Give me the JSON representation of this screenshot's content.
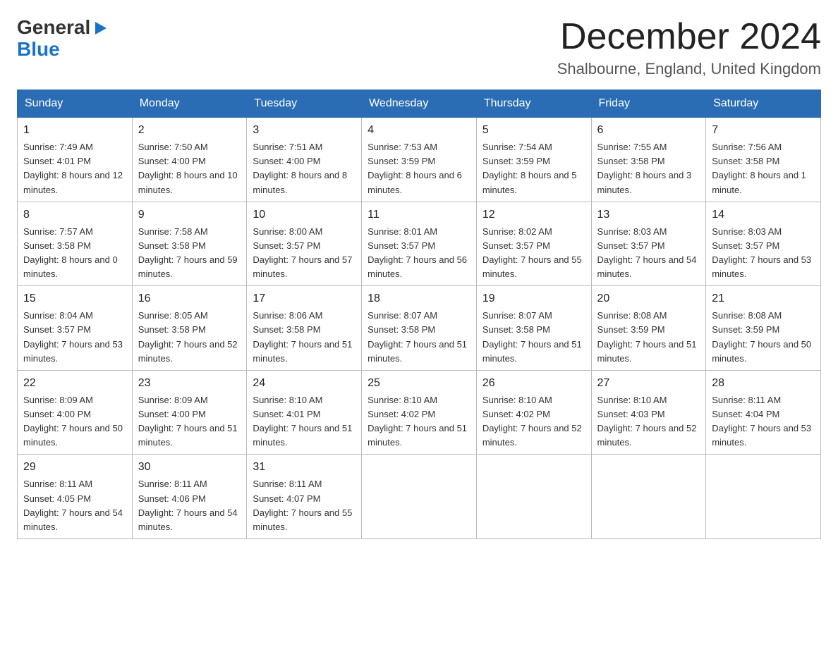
{
  "logo": {
    "general": "General",
    "blue": "Blue",
    "arrow": "▶"
  },
  "title": {
    "month": "December 2024",
    "location": "Shalbourne, England, United Kingdom"
  },
  "weekdays": [
    "Sunday",
    "Monday",
    "Tuesday",
    "Wednesday",
    "Thursday",
    "Friday",
    "Saturday"
  ],
  "weeks": [
    [
      {
        "day": "1",
        "sunrise": "7:49 AM",
        "sunset": "4:01 PM",
        "daylight": "8 hours and 12 minutes."
      },
      {
        "day": "2",
        "sunrise": "7:50 AM",
        "sunset": "4:00 PM",
        "daylight": "8 hours and 10 minutes."
      },
      {
        "day": "3",
        "sunrise": "7:51 AM",
        "sunset": "4:00 PM",
        "daylight": "8 hours and 8 minutes."
      },
      {
        "day": "4",
        "sunrise": "7:53 AM",
        "sunset": "3:59 PM",
        "daylight": "8 hours and 6 minutes."
      },
      {
        "day": "5",
        "sunrise": "7:54 AM",
        "sunset": "3:59 PM",
        "daylight": "8 hours and 5 minutes."
      },
      {
        "day": "6",
        "sunrise": "7:55 AM",
        "sunset": "3:58 PM",
        "daylight": "8 hours and 3 minutes."
      },
      {
        "day": "7",
        "sunrise": "7:56 AM",
        "sunset": "3:58 PM",
        "daylight": "8 hours and 1 minute."
      }
    ],
    [
      {
        "day": "8",
        "sunrise": "7:57 AM",
        "sunset": "3:58 PM",
        "daylight": "8 hours and 0 minutes."
      },
      {
        "day": "9",
        "sunrise": "7:58 AM",
        "sunset": "3:58 PM",
        "daylight": "7 hours and 59 minutes."
      },
      {
        "day": "10",
        "sunrise": "8:00 AM",
        "sunset": "3:57 PM",
        "daylight": "7 hours and 57 minutes."
      },
      {
        "day": "11",
        "sunrise": "8:01 AM",
        "sunset": "3:57 PM",
        "daylight": "7 hours and 56 minutes."
      },
      {
        "day": "12",
        "sunrise": "8:02 AM",
        "sunset": "3:57 PM",
        "daylight": "7 hours and 55 minutes."
      },
      {
        "day": "13",
        "sunrise": "8:03 AM",
        "sunset": "3:57 PM",
        "daylight": "7 hours and 54 minutes."
      },
      {
        "day": "14",
        "sunrise": "8:03 AM",
        "sunset": "3:57 PM",
        "daylight": "7 hours and 53 minutes."
      }
    ],
    [
      {
        "day": "15",
        "sunrise": "8:04 AM",
        "sunset": "3:57 PM",
        "daylight": "7 hours and 53 minutes."
      },
      {
        "day": "16",
        "sunrise": "8:05 AM",
        "sunset": "3:58 PM",
        "daylight": "7 hours and 52 minutes."
      },
      {
        "day": "17",
        "sunrise": "8:06 AM",
        "sunset": "3:58 PM",
        "daylight": "7 hours and 51 minutes."
      },
      {
        "day": "18",
        "sunrise": "8:07 AM",
        "sunset": "3:58 PM",
        "daylight": "7 hours and 51 minutes."
      },
      {
        "day": "19",
        "sunrise": "8:07 AM",
        "sunset": "3:58 PM",
        "daylight": "7 hours and 51 minutes."
      },
      {
        "day": "20",
        "sunrise": "8:08 AM",
        "sunset": "3:59 PM",
        "daylight": "7 hours and 51 minutes."
      },
      {
        "day": "21",
        "sunrise": "8:08 AM",
        "sunset": "3:59 PM",
        "daylight": "7 hours and 50 minutes."
      }
    ],
    [
      {
        "day": "22",
        "sunrise": "8:09 AM",
        "sunset": "4:00 PM",
        "daylight": "7 hours and 50 minutes."
      },
      {
        "day": "23",
        "sunrise": "8:09 AM",
        "sunset": "4:00 PM",
        "daylight": "7 hours and 51 minutes."
      },
      {
        "day": "24",
        "sunrise": "8:10 AM",
        "sunset": "4:01 PM",
        "daylight": "7 hours and 51 minutes."
      },
      {
        "day": "25",
        "sunrise": "8:10 AM",
        "sunset": "4:02 PM",
        "daylight": "7 hours and 51 minutes."
      },
      {
        "day": "26",
        "sunrise": "8:10 AM",
        "sunset": "4:02 PM",
        "daylight": "7 hours and 52 minutes."
      },
      {
        "day": "27",
        "sunrise": "8:10 AM",
        "sunset": "4:03 PM",
        "daylight": "7 hours and 52 minutes."
      },
      {
        "day": "28",
        "sunrise": "8:11 AM",
        "sunset": "4:04 PM",
        "daylight": "7 hours and 53 minutes."
      }
    ],
    [
      {
        "day": "29",
        "sunrise": "8:11 AM",
        "sunset": "4:05 PM",
        "daylight": "7 hours and 54 minutes."
      },
      {
        "day": "30",
        "sunrise": "8:11 AM",
        "sunset": "4:06 PM",
        "daylight": "7 hours and 54 minutes."
      },
      {
        "day": "31",
        "sunrise": "8:11 AM",
        "sunset": "4:07 PM",
        "daylight": "7 hours and 55 minutes."
      },
      null,
      null,
      null,
      null
    ]
  ]
}
